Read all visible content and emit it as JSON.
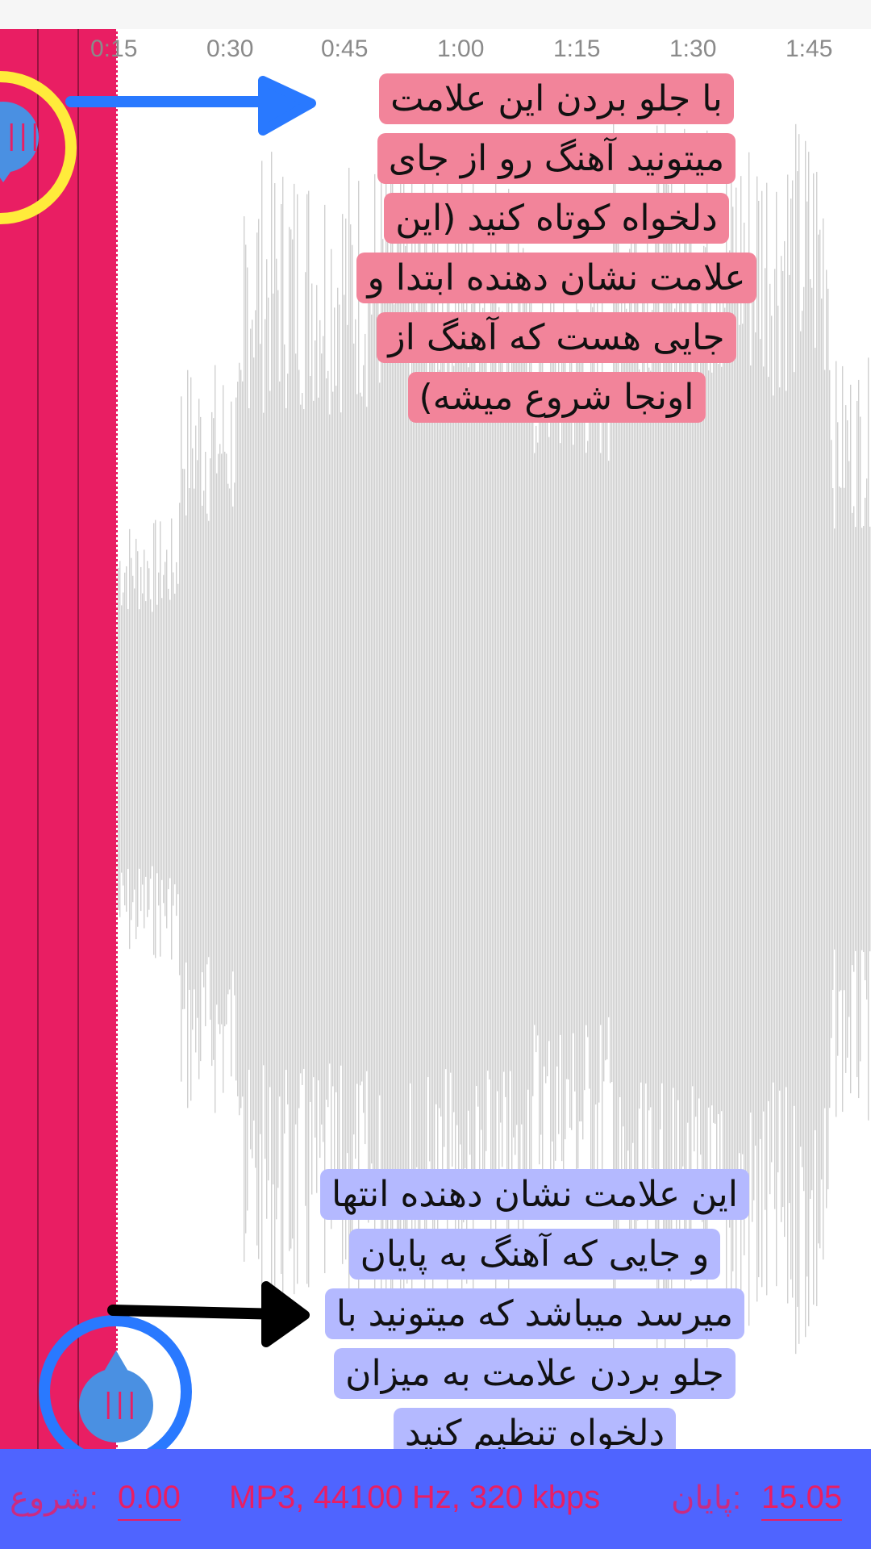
{
  "timeline": {
    "ticks": [
      "0:15",
      "0:30",
      "0:45",
      "1:00",
      "1:15",
      "1:30",
      "1:45"
    ]
  },
  "callouts": {
    "start": [
      "با جلو بردن این علامت",
      "میتونید آهنگ رو از جای",
      "دلخواه کوتاه کنید (این",
      "علامت نشان دهنده ابتدا و",
      "جایی هست که آهنگ از",
      "اونجا شروع میشه)"
    ],
    "end": [
      "این علامت نشان دهنده انتها",
      "و جایی که آهنگ به پایان",
      "میرسد میباشد که میتونید با",
      "جلو بردن علامت به میزان",
      "دلخواه تنظیم کنید"
    ]
  },
  "footer": {
    "start_label": "شروع:",
    "start_value": "0.00",
    "format_info": "MP3, 44100 Hz, 320 kbps",
    "end_label": "پایان:",
    "end_value": "15.05"
  },
  "colors": {
    "selection": "#e91e63",
    "waveform": "#d0d0d0",
    "footer_bg": "#4f64ff",
    "start_ring": "#ffeb3b",
    "end_ring": "#2979ff",
    "handle": "#4a90e2"
  },
  "icons": {
    "start_handle": "grip-handle-icon",
    "end_handle": "grip-handle-icon",
    "arrow_start": "arrow-right-icon",
    "arrow_end": "arrow-right-icon"
  }
}
